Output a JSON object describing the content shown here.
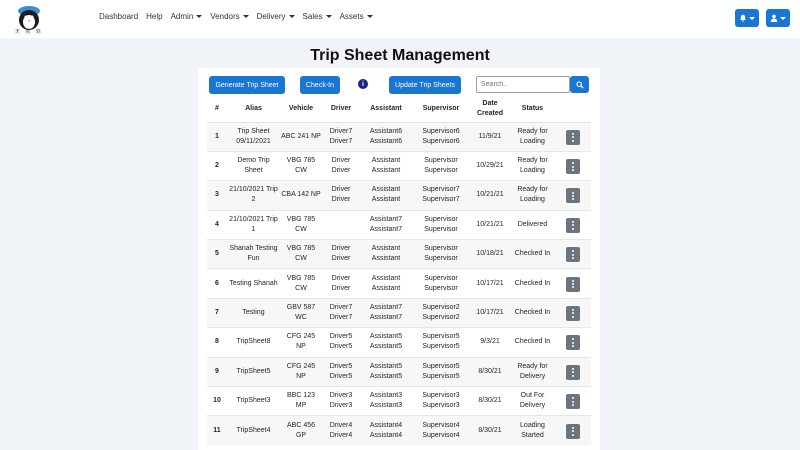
{
  "nav": {
    "links": [
      {
        "label": "Dashboard",
        "dropdown": false
      },
      {
        "label": "Help",
        "dropdown": false
      },
      {
        "label": "Admin",
        "dropdown": true
      },
      {
        "label": "Vendors",
        "dropdown": true
      },
      {
        "label": "Delivery",
        "dropdown": true
      },
      {
        "label": "Sales",
        "dropdown": true
      },
      {
        "label": "Assets",
        "dropdown": true
      }
    ],
    "logo_text": "天 馬 商",
    "notification_icon": "bell-icon",
    "user_icon": "user-icon",
    "accent_color": "#1976d2"
  },
  "page": {
    "title": "Trip Sheet Management"
  },
  "toolbar": {
    "generate_label": "Generate Trip Sheet",
    "checkin_label": "Check-In",
    "info_icon_text": "i",
    "update_label": "Update Trip Sheets",
    "search_placeholder": "Search.."
  },
  "table": {
    "headers": [
      "#",
      "Alias",
      "Vehicle",
      "Driver",
      "Assistant",
      "Supervisor",
      "Date Created",
      "Status",
      ""
    ],
    "rows": [
      {
        "num": "1",
        "alias": "Trip Sheet 09/11/2021",
        "vehicle": "ABC 241 NP",
        "driver": "Driver7 Driver7",
        "assistant": "Assistant6 Assistant6",
        "supervisor": "Supervisor6 Supervisor6",
        "date": "11/9/21",
        "status": "Ready for Loading"
      },
      {
        "num": "2",
        "alias": "Demo Trip Sheet",
        "vehicle": "VBG 785 CW",
        "driver": "Driver Driver",
        "assistant": "Assistant Assistant",
        "supervisor": "Supervisor Supervisor",
        "date": "10/29/21",
        "status": "Ready for Loading"
      },
      {
        "num": "3",
        "alias": "21/10/2021 Trip 2",
        "vehicle": "CBA 142 NP",
        "driver": "Driver Driver",
        "assistant": "Assistant Assistant",
        "supervisor": "Supervisor7 Supervisor7",
        "date": "10/21/21",
        "status": "Ready for Loading"
      },
      {
        "num": "4",
        "alias": "21/10/2021 Trip 1",
        "vehicle": "VBG 785 CW",
        "driver": "",
        "assistant": "Assistant7 Assistant7",
        "supervisor": "Supervisor Supervisor",
        "date": "10/21/21",
        "status": "Delivered"
      },
      {
        "num": "5",
        "alias": "Shanah Testing Fun",
        "vehicle": "VBG 785 CW",
        "driver": "Driver Driver",
        "assistant": "Assistant Assistant",
        "supervisor": "Supervisor Supervisor",
        "date": "10/18/21",
        "status": "Checked In"
      },
      {
        "num": "6",
        "alias": "Testing Shanah",
        "vehicle": "VBG 785 CW",
        "driver": "Driver Driver",
        "assistant": "Assistant Assistant",
        "supervisor": "Supervisor Supervisor",
        "date": "10/17/21",
        "status": "Checked In"
      },
      {
        "num": "7",
        "alias": "Testing",
        "vehicle": "GBV 587 WC",
        "driver": "Driver7 Driver7",
        "assistant": "Assistant7 Assistant7",
        "supervisor": "Supervisor2 Supervisor2",
        "date": "10/17/21",
        "status": "Checked In"
      },
      {
        "num": "8",
        "alias": "TripSheet8",
        "vehicle": "CFG 245 NP",
        "driver": "Driver5 Driver5",
        "assistant": "Assistant5 Assistant5",
        "supervisor": "Supervisor5 Supervisor5",
        "date": "9/3/21",
        "status": "Checked In"
      },
      {
        "num": "9",
        "alias": "TripSheet5",
        "vehicle": "CFG 245 NP",
        "driver": "Driver5 Driver5",
        "assistant": "Assistant5 Assistant5",
        "supervisor": "Supervisor5 Supervisor5",
        "date": "8/30/21",
        "status": "Ready for Delivery"
      },
      {
        "num": "10",
        "alias": "TripSheet3",
        "vehicle": "BBC 123 MP",
        "driver": "Driver3 Driver3",
        "assistant": "Assistant3 Assistant3",
        "supervisor": "Supervisor3 Supervisor3",
        "date": "8/30/21",
        "status": "Out For Delivery"
      },
      {
        "num": "11",
        "alias": "TripSheet4",
        "vehicle": "ABC 456 GP",
        "driver": "Driver4 Driver4",
        "assistant": "Assistant4 Assistant4",
        "supervisor": "Supervisor4 Supervisor4",
        "date": "8/30/21",
        "status": "Loading Started"
      }
    ],
    "row_action_icon": "kebab-menu-icon"
  }
}
